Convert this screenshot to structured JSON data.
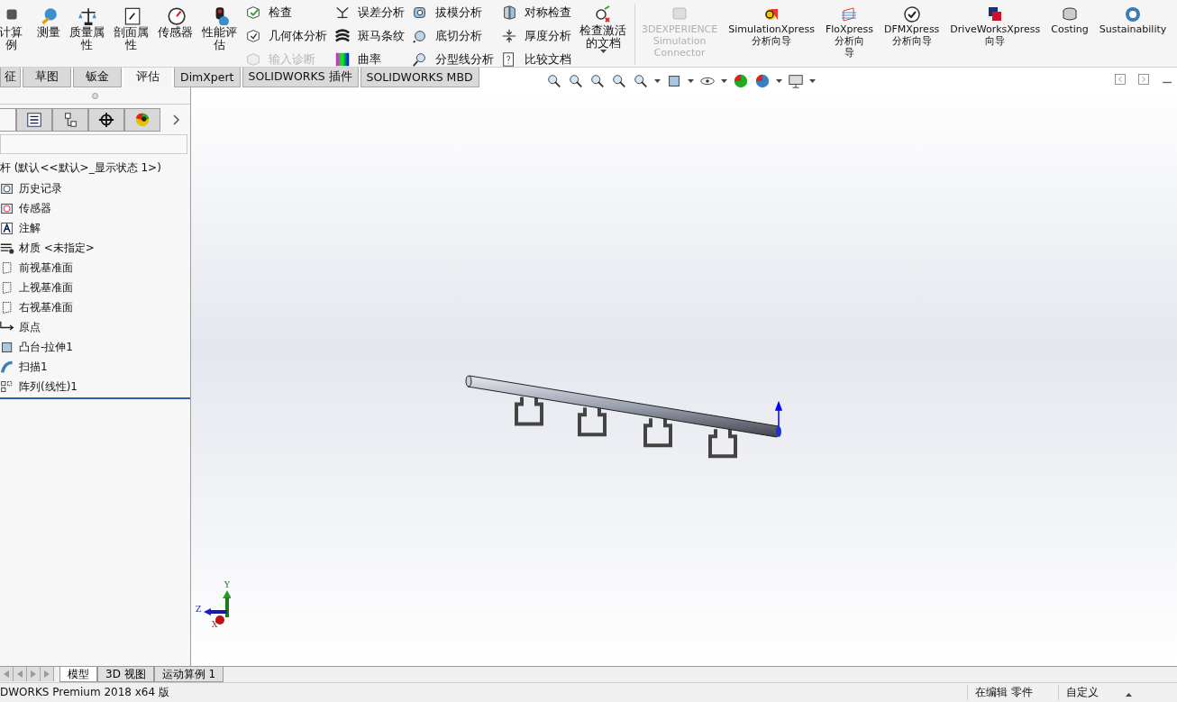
{
  "ribbon": {
    "left": [
      {
        "kind": "large",
        "lines": [
          "计算",
          "例"
        ]
      },
      {
        "kind": "large",
        "lines": [
          "测量"
        ]
      },
      {
        "kind": "large",
        "lines": [
          "质量属",
          "性"
        ]
      },
      {
        "kind": "large",
        "lines": [
          "剖面属",
          "性"
        ]
      },
      {
        "kind": "large",
        "lines": [
          "传感器"
        ]
      },
      {
        "kind": "large",
        "lines": [
          "性能评",
          "估"
        ]
      },
      {
        "kind": "stack",
        "items": [
          {
            "label": "检查",
            "disabled": false
          },
          {
            "label": "几何体分析",
            "disabled": false
          },
          {
            "label": "输入诊断",
            "disabled": true
          }
        ]
      },
      {
        "kind": "stack",
        "items": [
          {
            "label": "误差分析",
            "disabled": false
          },
          {
            "label": "斑马条纹",
            "disabled": false
          },
          {
            "label": "曲率",
            "disabled": false
          }
        ]
      },
      {
        "kind": "stack",
        "items": [
          {
            "label": "拔模分析",
            "disabled": false
          },
          {
            "label": "底切分析",
            "disabled": false
          },
          {
            "label": "分型线分析",
            "disabled": false
          }
        ]
      },
      {
        "kind": "stack",
        "items": [
          {
            "label": "对称检查",
            "disabled": false
          },
          {
            "label": "厚度分析",
            "disabled": false
          },
          {
            "label": "比较文档",
            "disabled": false
          }
        ]
      },
      {
        "kind": "dropdown",
        "lines": [
          "检查激活",
          "的文档"
        ]
      }
    ],
    "right": [
      {
        "lines": [
          "3DEXPERIENCE",
          "Simulation",
          "Connector"
        ],
        "disabled": true
      },
      {
        "lines": [
          "SimulationXpress",
          "分析向导"
        ],
        "disabled": false
      },
      {
        "lines": [
          "FloXpress",
          "分析向",
          "导"
        ],
        "disabled": false
      },
      {
        "lines": [
          "DFMXpress",
          "分析向导"
        ],
        "disabled": false
      },
      {
        "lines": [
          "DriveWorksXpress",
          "向导"
        ],
        "disabled": false
      },
      {
        "lines": [
          "Costing"
        ],
        "disabled": false
      },
      {
        "lines": [
          "Sustainability"
        ],
        "disabled": false
      }
    ]
  },
  "tabs": [
    {
      "label": "征",
      "selected": false
    },
    {
      "label": "草图",
      "selected": false
    },
    {
      "label": "钣金",
      "selected": false
    },
    {
      "label": "评估",
      "selected": true
    },
    {
      "label": "DimXpert",
      "selected": false
    },
    {
      "label": "SOLIDWORKS 插件",
      "selected": false
    },
    {
      "label": "SOLIDWORKS MBD",
      "selected": false
    }
  ],
  "tree": {
    "root": "杆  (默认<<默认>_显示状态 1>)",
    "items": [
      {
        "label": "历史记录"
      },
      {
        "label": "传感器"
      },
      {
        "label": "注解"
      },
      {
        "label": "材质 <未指定>"
      },
      {
        "label": "前视基准面"
      },
      {
        "label": "上视基准面"
      },
      {
        "label": "右视基准面"
      },
      {
        "label": "原点"
      },
      {
        "label": "凸台-拉伸1"
      },
      {
        "label": "扫描1"
      },
      {
        "label": "阵列(线性)1"
      }
    ]
  },
  "panel_tabs": [
    {
      "selected": true
    },
    {
      "selected": false
    },
    {
      "selected": false
    },
    {
      "selected": false
    },
    {
      "selected": false
    }
  ],
  "triad": {
    "y": "Y",
    "z": "Z",
    "x": "X"
  },
  "bottom_tabs": [
    {
      "label": "模型",
      "selected": true
    },
    {
      "label": "3D 视图",
      "selected": false
    },
    {
      "label": "运动算例 1",
      "selected": false
    }
  ],
  "status_bar": {
    "product": "DWORKS Premium 2018 x64 版",
    "mode": "在编辑 零件",
    "units": "自定义"
  }
}
